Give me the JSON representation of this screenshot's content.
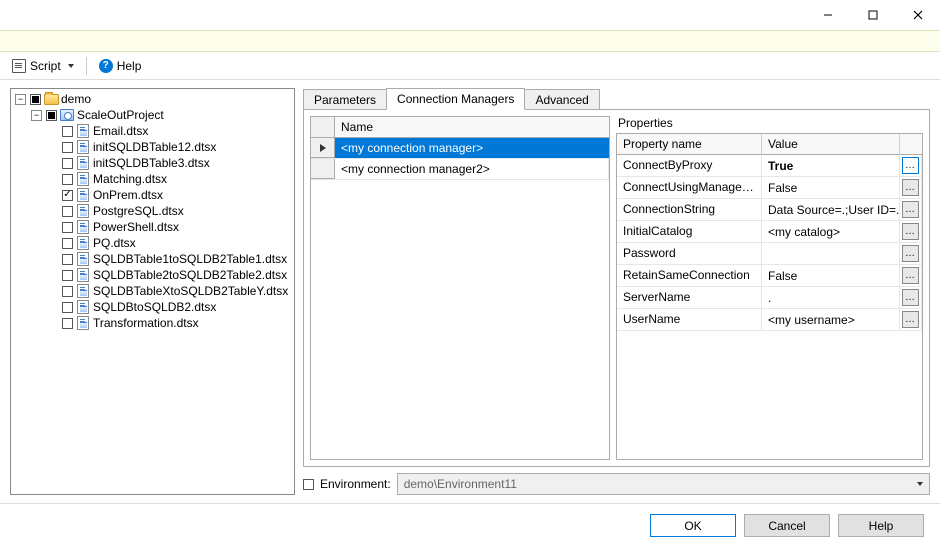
{
  "toolbar": {
    "script_label": "Script",
    "help_label": "Help"
  },
  "tree": {
    "root": "demo",
    "project": "ScaleOutProject",
    "packages": [
      {
        "name": "Email.dtsx",
        "checked": false
      },
      {
        "name": "initSQLDBTable12.dtsx",
        "checked": false
      },
      {
        "name": "initSQLDBTable3.dtsx",
        "checked": false
      },
      {
        "name": "Matching.dtsx",
        "checked": false
      },
      {
        "name": "OnPrem.dtsx",
        "checked": true
      },
      {
        "name": "PostgreSQL.dtsx",
        "checked": false
      },
      {
        "name": "PowerShell.dtsx",
        "checked": false
      },
      {
        "name": "PQ.dtsx",
        "checked": false
      },
      {
        "name": "SQLDBTable1toSQLDB2Table1.dtsx",
        "checked": false
      },
      {
        "name": "SQLDBTable2toSQLDB2Table2.dtsx",
        "checked": false
      },
      {
        "name": "SQLDBTableXtoSQLDB2TableY.dtsx",
        "checked": false
      },
      {
        "name": "SQLDBtoSQLDB2.dtsx",
        "checked": false
      },
      {
        "name": "Transformation.dtsx",
        "checked": false
      }
    ]
  },
  "tabs": {
    "parameters": "Parameters",
    "connection_managers": "Connection Managers",
    "advanced": "Advanced"
  },
  "cm_list": {
    "header_name": "Name",
    "rows": [
      {
        "name": "<my connection manager>",
        "selected": true
      },
      {
        "name": "<my connection manager2>",
        "selected": false
      }
    ]
  },
  "properties": {
    "label": "Properties",
    "header_property": "Property name",
    "header_value": "Value",
    "rows": [
      {
        "name": "ConnectByProxy",
        "value": "True",
        "bold": true,
        "highlight": true
      },
      {
        "name": "ConnectUsingManagedIdentity",
        "value": "False"
      },
      {
        "name": "ConnectionString",
        "value": "Data Source=.;User ID=..."
      },
      {
        "name": "InitialCatalog",
        "value": "<my catalog>"
      },
      {
        "name": "Password",
        "value": ""
      },
      {
        "name": "RetainSameConnection",
        "value": "False"
      },
      {
        "name": "ServerName",
        "value": "."
      },
      {
        "name": "UserName",
        "value": "<my username>"
      }
    ]
  },
  "environment": {
    "label": "Environment:",
    "value": "demo\\Environment11",
    "checked": false
  },
  "footer": {
    "ok": "OK",
    "cancel": "Cancel",
    "help": "Help"
  }
}
